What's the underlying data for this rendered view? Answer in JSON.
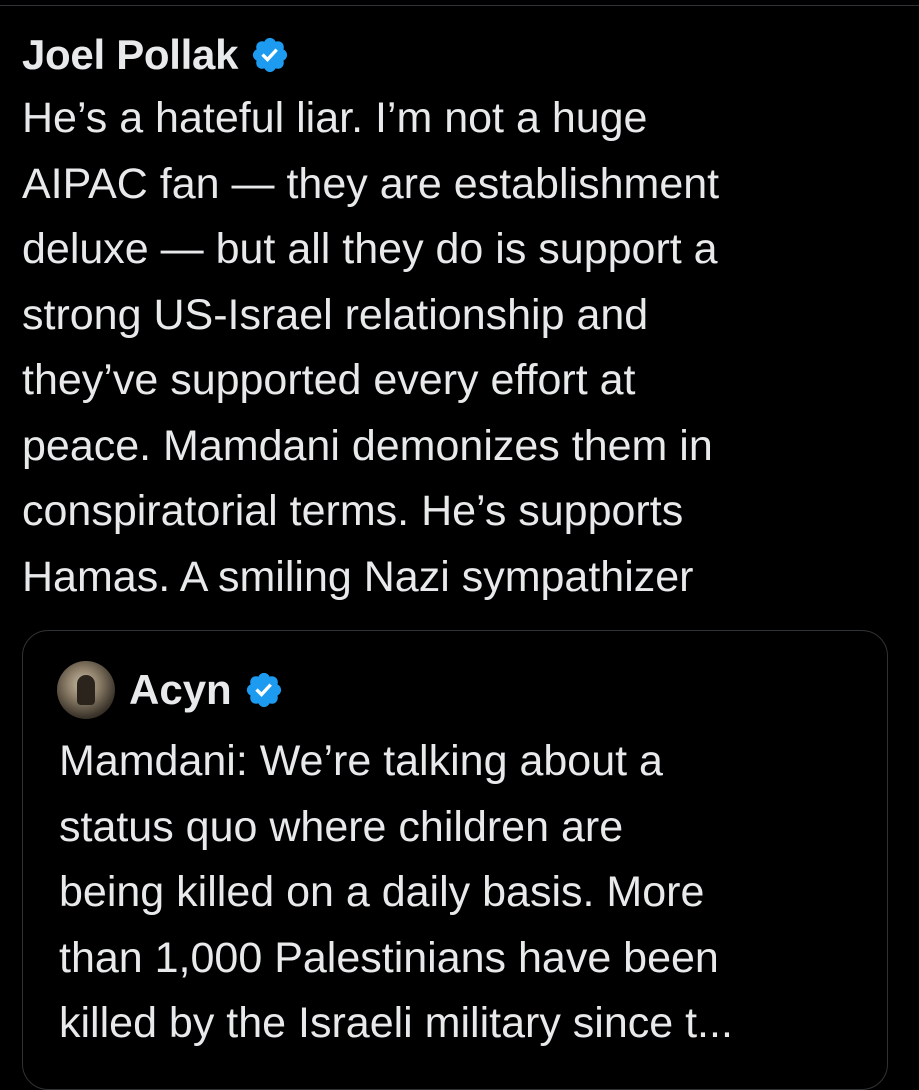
{
  "tweet": {
    "author": "Joel Pollak",
    "verified_icon": "verified-badge-icon",
    "body_lines": [
      "He’s a hateful liar. I’m not a huge",
      "AIPAC fan — they are establishment",
      "deluxe — but all they do is support a",
      "strong US-Israel relationship and",
      "they’ve supported every effort at",
      "peace. Mamdani demonizes them in",
      "conspiratorial terms. He’s supports",
      "Hamas. A smiling Nazi sympathizer"
    ]
  },
  "quote": {
    "author": "Acyn",
    "verified_icon": "verified-badge-icon",
    "avatar_icon": "avatar-icon",
    "body_lines": [
      "Mamdani: We’re talking about a",
      "status quo where children are",
      "being killed on a daily basis. More",
      "than 1,000 Palestinians have been",
      "killed by the Israeli military since t..."
    ]
  },
  "colors": {
    "background": "#000000",
    "text": "#e7e9ea",
    "verified": "#1d9bf0",
    "border": "#2f3336"
  }
}
